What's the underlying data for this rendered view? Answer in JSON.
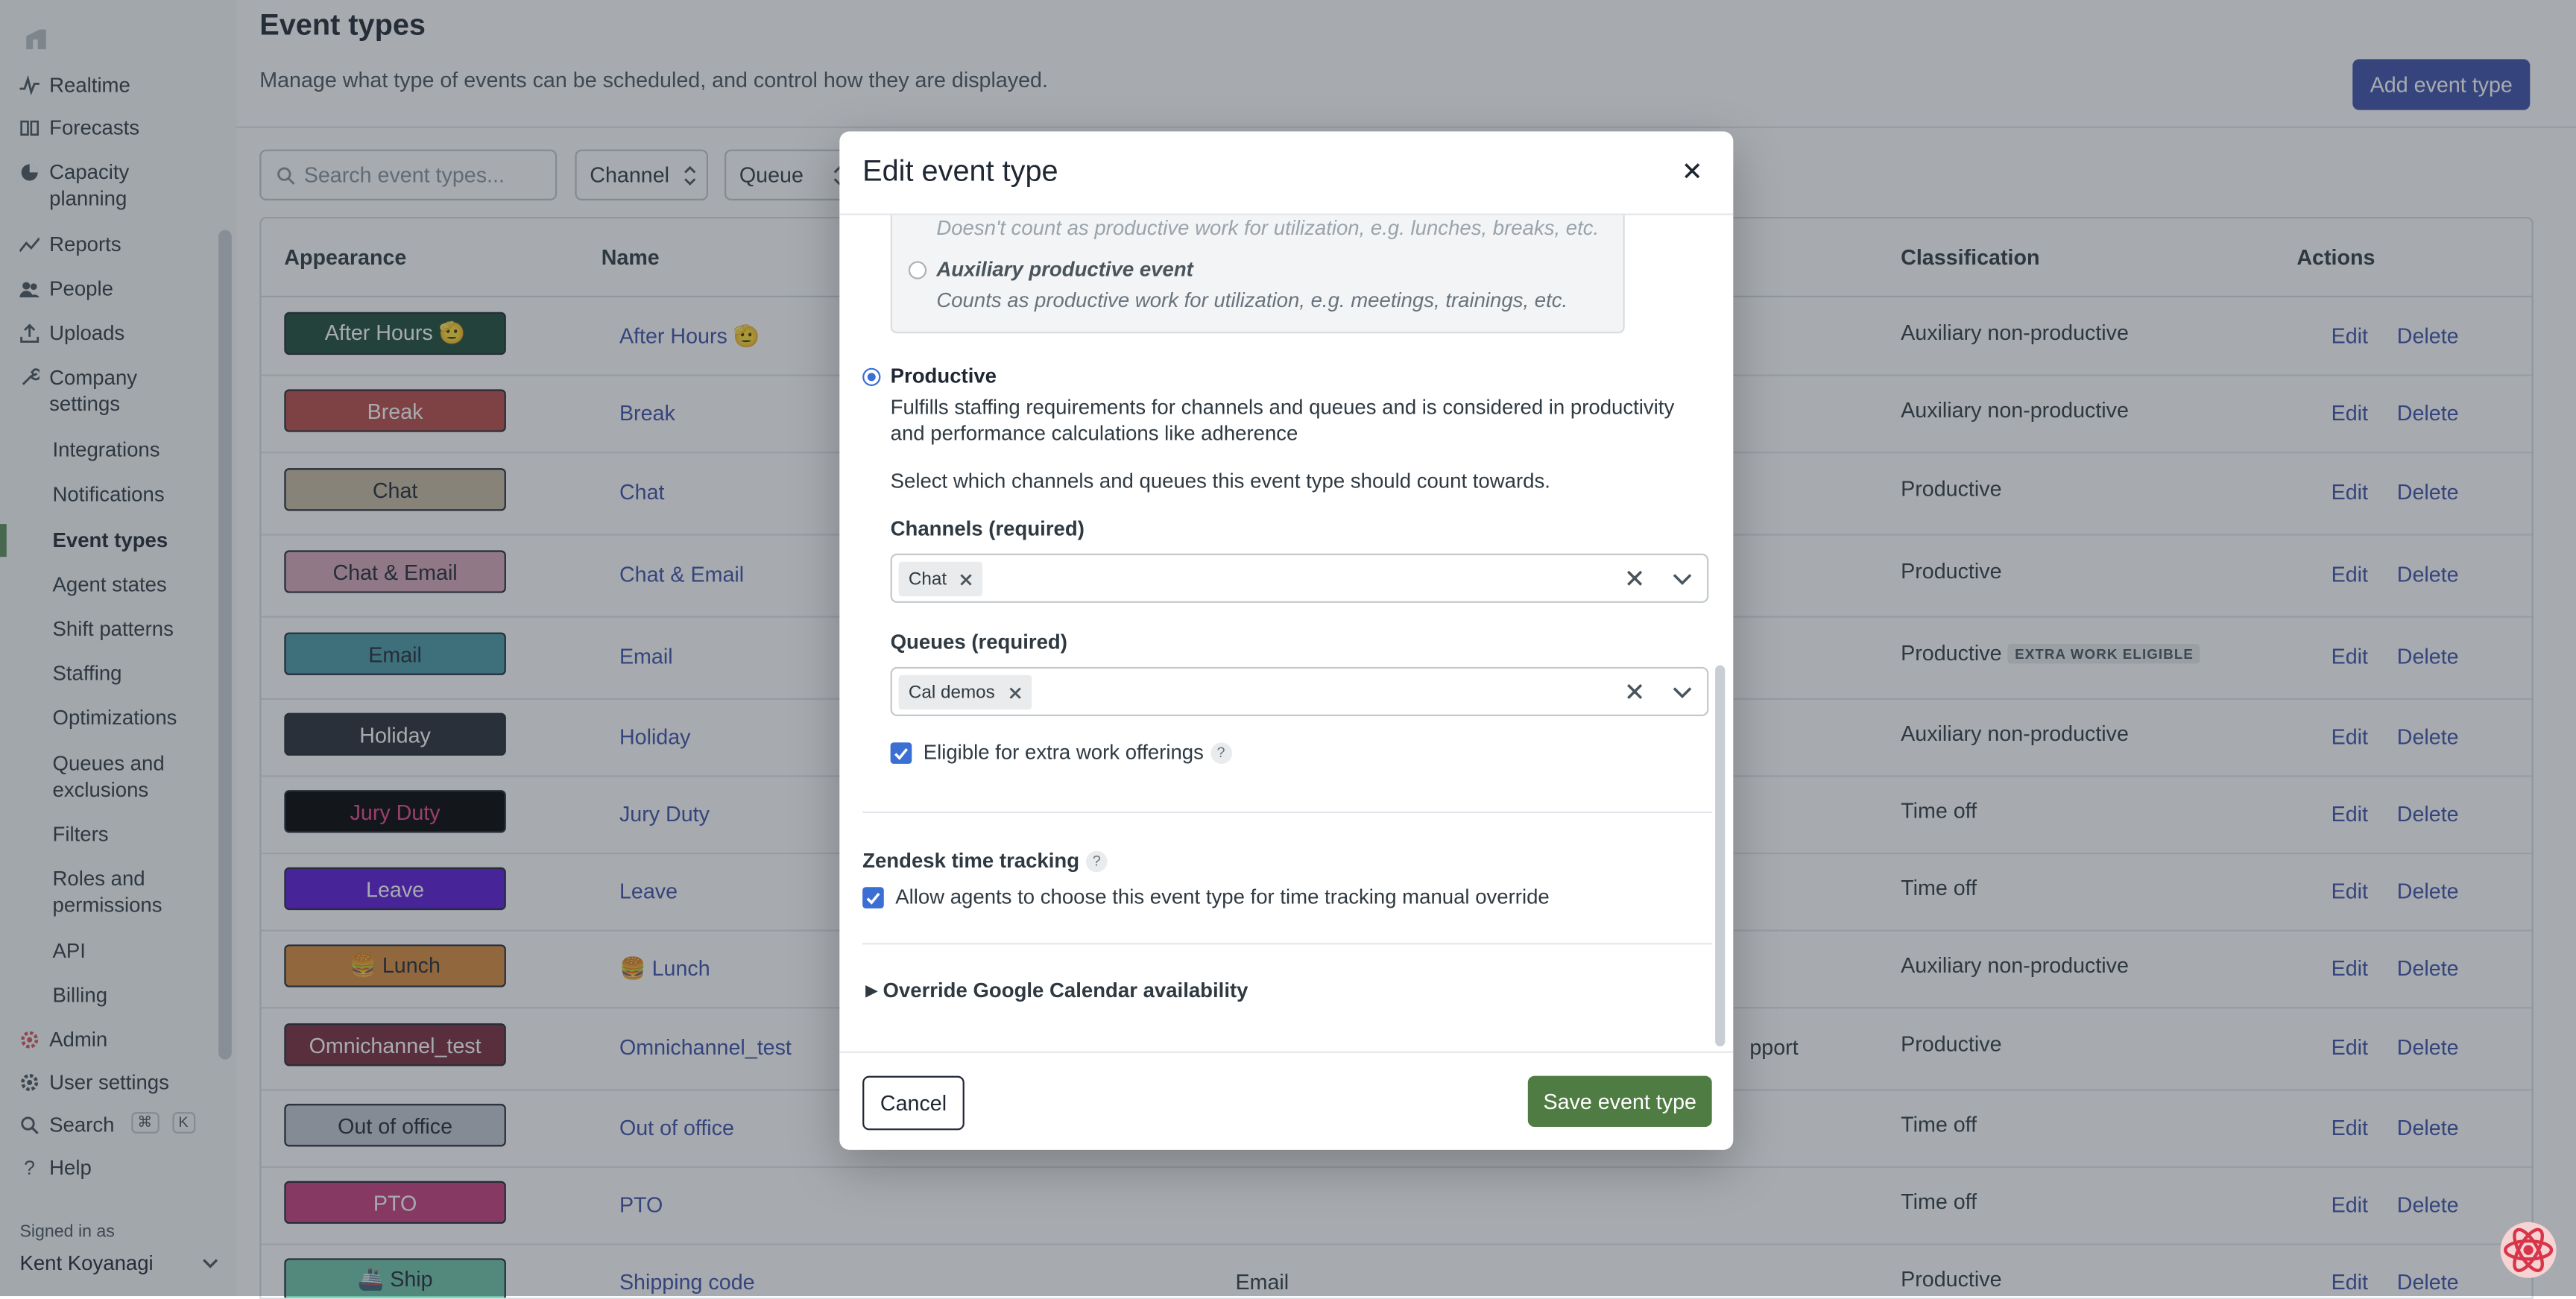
{
  "sidebar": {
    "partial_top": "Realtime",
    "items": [
      {
        "label": "Forecasts",
        "icon": "book-icon"
      },
      {
        "label": "Capacity\nplanning",
        "icon": "pie-chart-icon"
      },
      {
        "label": "Reports",
        "icon": "trend-icon"
      },
      {
        "label": "People",
        "icon": "people-icon"
      },
      {
        "label": "Uploads",
        "icon": "upload-icon"
      },
      {
        "label": "Company\nsettings",
        "icon": "wrench-icon"
      }
    ],
    "sub_items": [
      "Integrations",
      "Notifications",
      "Event types",
      "Agent states",
      "Shift patterns",
      "Staffing",
      "Optimizations",
      "Queues and\nexclusions",
      "Filters",
      "Roles and\npermissions",
      "API",
      "Billing"
    ],
    "bottom": {
      "admin": "Admin",
      "user_settings": "User settings",
      "search": "Search",
      "search_keys": [
        "⌘",
        "K"
      ],
      "help": "Help",
      "signed_in_as": "Signed in as",
      "user_name": "Kent Koyanagi"
    }
  },
  "header": {
    "title": "Event types",
    "subtitle": "Manage what type of events can be scheduled, and control how they are displayed.",
    "add_button": "Add event type"
  },
  "filters": {
    "search_placeholder": "Search event types...",
    "channel": "Channel",
    "queue": "Queue"
  },
  "table": {
    "columns": [
      "Appearance",
      "Name",
      "Classification",
      "Actions"
    ],
    "rows": [
      {
        "badge": "After Hours 🫡",
        "name": "After Hours 🫡",
        "classification": "Auxiliary non-productive",
        "bg": "#1e4a3a",
        "fg": "#ffffff"
      },
      {
        "badge": "Break",
        "name": "Break",
        "classification": "Auxiliary non-productive",
        "bg": "#b94a48",
        "fg": "#ffffff"
      },
      {
        "badge": "Chat",
        "name": "Chat",
        "classification": "Productive",
        "bg": "#c9bba2",
        "fg": "#1f2733"
      },
      {
        "badge": "Chat & Email",
        "name": "Chat & Email",
        "classification": "Productive",
        "bg": "#d9a7b8",
        "fg": "#1f2733"
      },
      {
        "badge": "Email",
        "name": "Email",
        "classification": "Productive",
        "bg": "#4a9aa8",
        "fg": "#1f2733",
        "extra": "EXTRA WORK ELIGIBLE"
      },
      {
        "badge": "Holiday",
        "name": "Holiday",
        "classification": "Auxiliary non-productive",
        "bg": "#262b35",
        "fg": "#ffffff"
      },
      {
        "badge": "Jury Duty",
        "name": "Jury Duty",
        "classification": "Time off",
        "bg": "#000000",
        "fg": "#e8458b"
      },
      {
        "badge": "Leave",
        "name": "Leave",
        "classification": "Time off",
        "bg": "#5a17d6",
        "fg": "#ffffff"
      },
      {
        "badge": "🍔 Lunch",
        "name": "🍔 Lunch",
        "classification": "Auxiliary non-productive",
        "bg": "#d98a3c",
        "fg": "#1f2733"
      },
      {
        "badge": "Omnichannel_test",
        "name": "Omnichannel_test",
        "classification": "Productive",
        "bg": "#7a2a3c",
        "fg": "#ffffff",
        "cell_extra": "pport"
      },
      {
        "badge": "Out of office",
        "name": "Out of office",
        "classification": "Time off",
        "bg": "#c4c8d0",
        "fg": "#1f2733"
      },
      {
        "badge": "PTO",
        "name": "PTO",
        "classification": "Time off",
        "bg": "#c63d7d",
        "fg": "#ffffff"
      },
      {
        "badge": "🚢 Ship",
        "name": "Shipping code",
        "classification": "Productive",
        "bg": "#6ec4a8",
        "fg": "#1f2733",
        "cell_extra": "Email"
      }
    ],
    "edit_label": "Edit",
    "delete_label": "Delete"
  },
  "modal": {
    "title": "Edit event type",
    "nonprod_desc": "Doesn't count as productive work for utilization, e.g. lunches, breaks, etc.",
    "aux_prod_title": "Auxiliary productive event",
    "aux_prod_desc": "Counts as productive work for utilization, e.g. meetings, trainings, etc.",
    "productive_title": "Productive",
    "productive_desc": "Fulfills staffing requirements for channels and queues and is considered in productivity and performance calculations like adherence",
    "select_hint": "Select which channels and queues this event type should count towards.",
    "channels_label": "Channels (required)",
    "channels_value": "Chat",
    "queues_label": "Queues (required)",
    "queues_value": "Cal demos",
    "extra_work_label": "Eligible for extra work offerings",
    "zendesk_title": "Zendesk time tracking",
    "zendesk_checkbox": "Allow agents to choose this event type for time tracking manual override",
    "override_label": "Override Google Calendar availability",
    "cancel": "Cancel",
    "save": "Save event type"
  },
  "colors": {
    "primary": "#3b4ea8",
    "save_green": "#4f7c42",
    "checkbox_blue": "#3b6fd4"
  }
}
